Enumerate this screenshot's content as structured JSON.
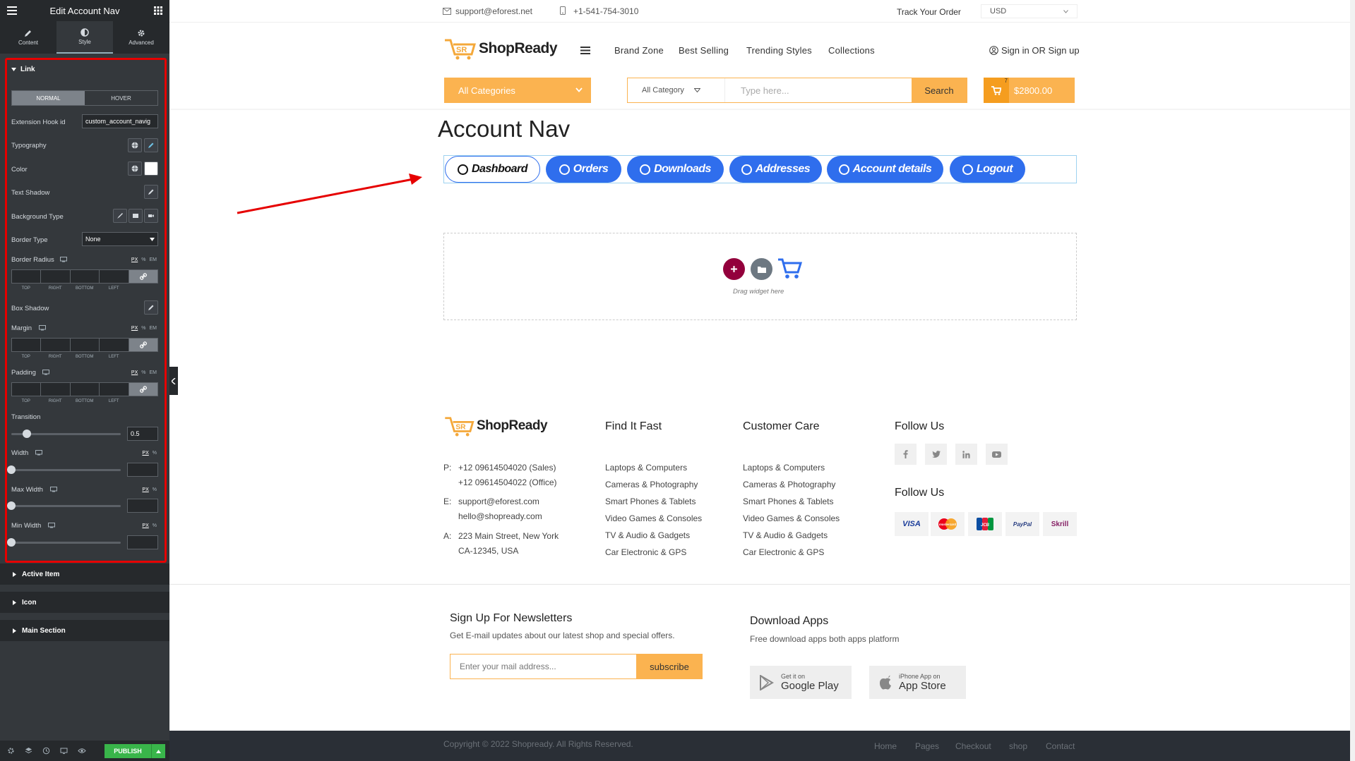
{
  "editor": {
    "title": "Edit Account Nav",
    "tabs": [
      {
        "label": "Content",
        "icon": "pencil-icon"
      },
      {
        "label": "Style",
        "icon": "half-circle-icon",
        "active": true
      },
      {
        "label": "Advanced",
        "icon": "gear-icon"
      }
    ],
    "section_link": "Link",
    "state_normal": "NORMAL",
    "state_hover": "HOVER",
    "extension_label": "Extension Hook id",
    "extension_value": "custom_account_navig",
    "typography": "Typography",
    "color": "Color",
    "text_shadow": "Text Shadow",
    "background_type": "Background Type",
    "border_type": "Border Type",
    "border_type_value": "None",
    "border_radius": "Border Radius",
    "box_shadow": "Box Shadow",
    "margin": "Margin",
    "padding": "Padding",
    "transition": "Transition",
    "transition_value": "0.5",
    "width": "Width",
    "max_width": "Max Width",
    "min_width": "Min Width",
    "dim_labels": [
      "TOP",
      "RIGHT",
      "BOTTOM",
      "LEFT"
    ],
    "units3": [
      "PX",
      "%",
      "EM"
    ],
    "units2": [
      "PX",
      "%"
    ],
    "collapsed_sections": [
      "Active Item",
      "Icon",
      "Main Section"
    ],
    "publish": "PUBLISH",
    "accent_color": "#39b54a",
    "highlight_color": "#e60000"
  },
  "site": {
    "email": "support@eforest.net",
    "phone": "+1-541-754-3010",
    "track_order": "Track Your Order",
    "currency": "USD",
    "logo": "ShopReady",
    "menu": [
      "Brand Zone",
      "Best Selling",
      "Trending Styles",
      "Collections"
    ],
    "signin": "Sign in OR Sign up",
    "all_categories": "All Categories",
    "search_category": "All Category",
    "search_placeholder": "Type here...",
    "search_button": "Search",
    "cart_count": "7",
    "cart_total": "$2800.00",
    "accent_color": "#fbb350"
  },
  "account_nav": {
    "title": "Account Nav",
    "items": [
      "Dashboard",
      "Orders",
      "Downloads",
      "Addresses",
      "Account details",
      "Logout"
    ],
    "active_item": "Dashboard",
    "pill_color": "#2f6eed"
  },
  "dropzone": {
    "text": "Drag widget here"
  },
  "footer": {
    "logo": "ShopReady",
    "phone_label": "P:",
    "phone_sales": "+12 09614504020 (Sales)",
    "phone_office": "+12 09614504022 (Office)",
    "email_label": "E:",
    "email1": "support@eforest.com",
    "email2": "hello@shopready.com",
    "address_label": "A:",
    "address1": "223 Main Street, New York",
    "address2": "CA-12345, USA",
    "find_title": "Find It Fast",
    "care_title": "Customer Care",
    "links": [
      "Laptops & Computers",
      "Cameras & Photography",
      "Smart Phones & Tablets",
      "Video Games & Consoles",
      "TV & Audio & Gadgets",
      "Car Electronic & GPS"
    ],
    "follow_title": "Follow Us",
    "follow_title2": "Follow Us",
    "social_icons": [
      "facebook-icon",
      "twitter-icon",
      "linkedin-icon",
      "youtube-icon"
    ],
    "payments": [
      "VISA",
      "mastercard",
      "JCB",
      "PayPal",
      "Skrill"
    ],
    "newsletter_title": "Sign Up For Newsletters",
    "newsletter_text": "Get E-mail updates about our latest shop and special offers.",
    "newsletter_placeholder": "Enter your mail address...",
    "subscribe": "subscribe",
    "apps_title": "Download Apps",
    "apps_text": "Free download apps both apps platform",
    "google_small": "Get it on",
    "google_big": "Google Play",
    "apple_small": "iPhone App on",
    "apple_big": "App Store",
    "copyright": "Copyright © 2022 Shopready. All Rights Reserved.",
    "bottom_links": [
      "Home",
      "Pages",
      "Checkout",
      "shop",
      "Contact"
    ]
  }
}
